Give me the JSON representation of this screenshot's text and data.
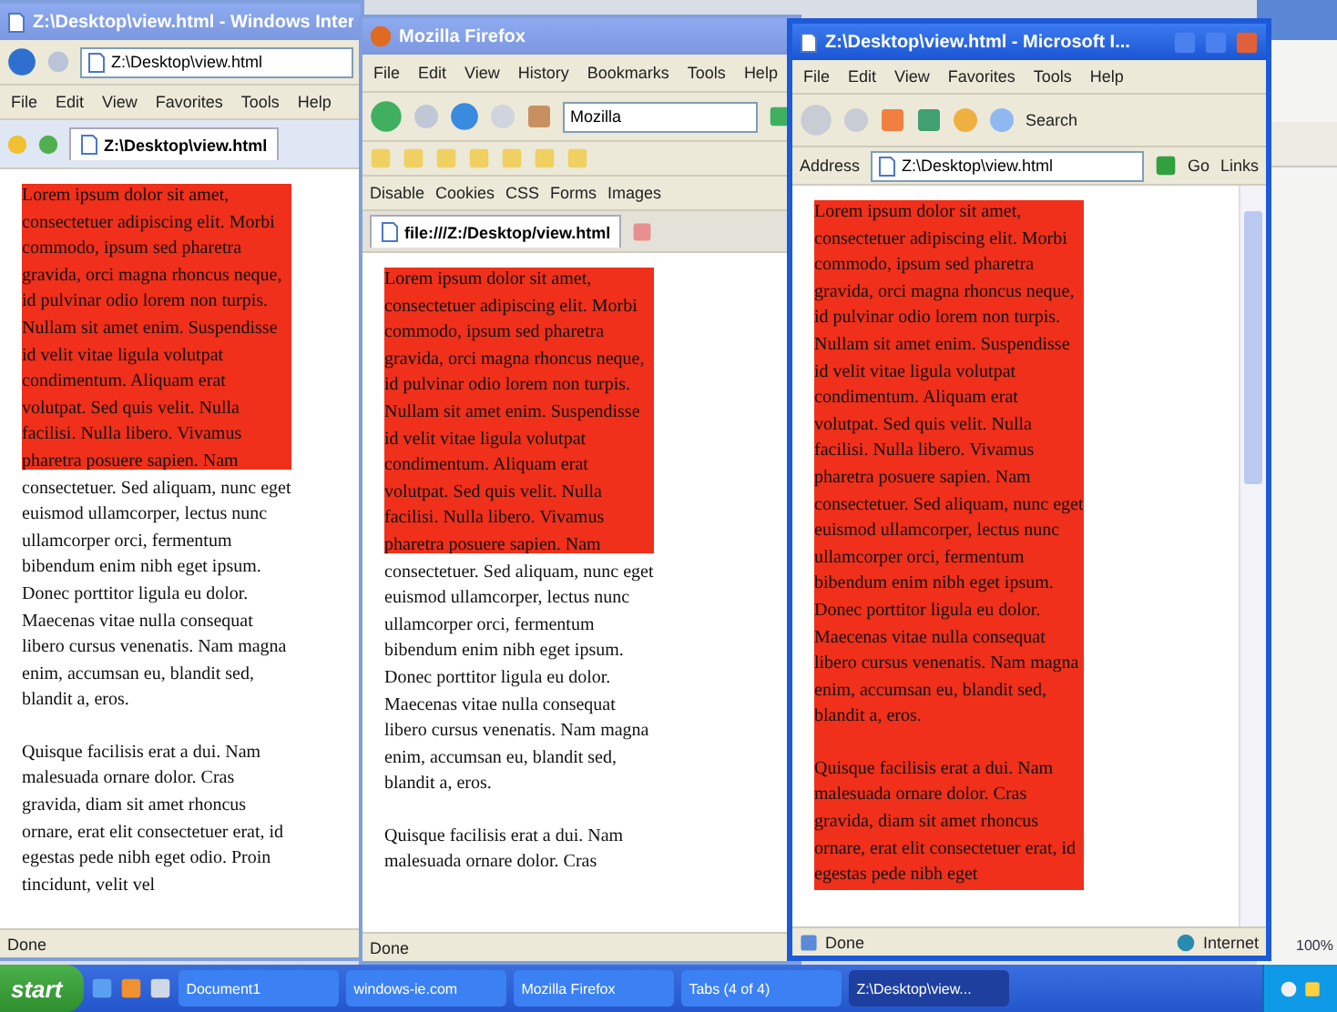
{
  "windows": [
    {
      "kind": "ie7",
      "title": "Z:\\Desktop\\view.html - Windows Inter",
      "address": "Z:\\Desktop\\view.html",
      "menu": [
        "File",
        "Edit",
        "View",
        "Favorites",
        "Tools",
        "Help"
      ],
      "tab": "Z:\\Desktop\\view.html",
      "status": "Done",
      "page": {
        "box_expands": false,
        "paragraphs": [
          "Lorem ipsum dolor sit amet, consectetuer adipiscing elit. Morbi commodo, ipsum sed pharetra gravida, orci magna rhoncus neque, id pulvinar odio lorem non turpis. Nullam sit amet enim. Suspendisse id velit vitae ligula volutpat condimentum. Aliquam erat volutpat. Sed quis velit. Nulla facilisi. Nulla libero. Vivamus pharetra posuere sapien. Nam consectetuer. Sed aliquam, nunc eget euismod ullamcorper, lectus nunc ullamcorper orci, fermentum bibendum enim nibh eget ipsum. Donec porttitor ligula eu dolor. Maecenas vitae nulla consequat libero cursus venenatis. Nam magna enim, accumsan eu, blandit sed, blandit a, eros.",
          "Quisque facilisis erat a dui. Nam malesuada ornare dolor. Cras gravida, diam sit amet rhoncus ornare, erat elit consectetuer erat, id egestas pede nibh eget odio. Proin tincidunt, velit vel"
        ]
      }
    },
    {
      "kind": "firefox",
      "title": "Mozilla Firefox",
      "menu": [
        "File",
        "Edit",
        "View",
        "History",
        "Bookmarks",
        "Tools",
        "Help"
      ],
      "search": "Mozilla",
      "devbar": [
        "Disable",
        "Cookies",
        "CSS",
        "Forms",
        "Images"
      ],
      "tab": "file:///Z:/Desktop/view.html",
      "status": "Done",
      "page": {
        "box_expands": false,
        "paragraphs": [
          "Lorem ipsum dolor sit amet, consectetuer adipiscing elit. Morbi commodo, ipsum sed pharetra gravida, orci magna rhoncus neque, id pulvinar odio lorem non turpis. Nullam sit amet enim. Suspendisse id velit vitae ligula volutpat condimentum. Aliquam erat volutpat. Sed quis velit. Nulla facilisi. Nulla libero. Vivamus pharetra posuere sapien. Nam consectetuer. Sed aliquam, nunc eget euismod ullamcorper, lectus nunc ullamcorper orci, fermentum bibendum enim nibh eget ipsum. Donec porttitor ligula eu dolor. Maecenas vitae nulla consequat libero cursus venenatis. Nam magna enim, accumsan eu, blandit sed, blandit a, eros.",
          "Quisque facilisis erat a dui. Nam malesuada ornare dolor. Cras"
        ]
      }
    },
    {
      "kind": "ie6",
      "title": "Z:\\Desktop\\view.html - Microsoft I...",
      "menu": [
        "File",
        "Edit",
        "View",
        "Favorites",
        "Tools",
        "Help"
      ],
      "search": "Search",
      "address_label": "Address",
      "address": "Z:\\Desktop\\view.html",
      "go": "Go",
      "links": "Links",
      "status": "Done",
      "zone": "Internet",
      "page": {
        "box_expands": true,
        "paragraphs": [
          "Lorem ipsum dolor sit amet, consectetuer adipiscing elit. Morbi commodo, ipsum sed pharetra gravida, orci magna rhoncus neque, id pulvinar odio lorem non turpis. Nullam sit amet enim. Suspendisse id velit vitae ligula volutpat condimentum. Aliquam erat volutpat. Sed quis velit. Nulla facilisi. Nulla libero. Vivamus pharetra posuere sapien. Nam consectetuer. Sed aliquam, nunc eget euismod ullamcorper, lectus nunc ullamcorper orci, fermentum bibendum enim nibh eget ipsum. Donec porttitor ligula eu dolor. Maecenas vitae nulla consequat libero cursus venenatis. Nam magna enim, accumsan eu, blandit sed, blandit a, eros.",
          "Quisque facilisis erat a dui. Nam malesuada ornare dolor. Cras gravida, diam sit amet rhoncus ornare, erat elit consectetuer erat, id egestas pede nibh eget"
        ]
      }
    }
  ],
  "behind_status": "100%",
  "taskbar": {
    "start": "start",
    "buttons": [
      {
        "label": "Document1",
        "selected": false
      },
      {
        "label": "windows-ie.com",
        "selected": false
      },
      {
        "label": "Mozilla Firefox",
        "selected": false
      },
      {
        "label": "Tabs (4 of 4)",
        "selected": false
      },
      {
        "label": "Z:\\Desktop\\view...",
        "selected": true
      }
    ]
  }
}
